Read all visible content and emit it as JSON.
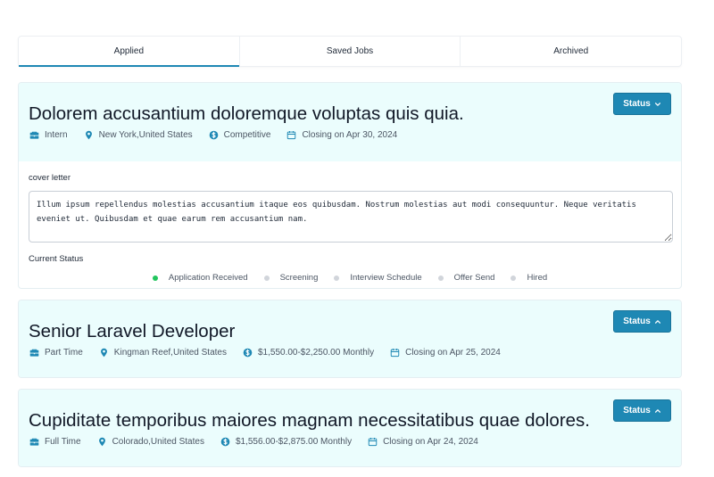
{
  "tabs": [
    {
      "label": "Applied",
      "active": true
    },
    {
      "label": "Saved Jobs",
      "active": false
    },
    {
      "label": "Archived",
      "active": false
    }
  ],
  "colors": {
    "accent": "#1e88b4",
    "card_header_bg": "#ebfdfd",
    "step_done": "#22c55e",
    "step_pending": "#d1d5db"
  },
  "jobs": [
    {
      "title": "Dolorem accusantium doloremque voluptas quis quia.",
      "status_label": "Status",
      "status_icon": "chevron-down-icon",
      "type": "Intern",
      "location": "New York,United States",
      "salary": "Competitive",
      "closing": "Closing on Apr 30, 2024",
      "cover_letter_label": "cover letter",
      "cover_letter": "Illum ipsum repellendus molestias accusantium itaque eos quibusdam. Nostrum molestias aut modi consequuntur. Neque veritatis eveniet ut. Quibusdam et quae earum rem accusantium nam.",
      "current_status_label": "Current Status",
      "steps": [
        {
          "label": "Application Received",
          "done": true
        },
        {
          "label": "Screening",
          "done": false
        },
        {
          "label": "Interview Schedule",
          "done": false
        },
        {
          "label": "Offer Send",
          "done": false
        },
        {
          "label": "Hired",
          "done": false
        }
      ]
    },
    {
      "title": "Senior Laravel Developer",
      "status_label": "Status",
      "status_icon": "chevron-up-icon",
      "type": "Part Time",
      "location": "Kingman Reef,United States",
      "salary": "$1,550.00-$2,250.00 Monthly",
      "closing": "Closing on Apr 25, 2024"
    },
    {
      "title": "Cupiditate temporibus maiores magnam necessitatibus quae dolores.",
      "status_label": "Status",
      "status_icon": "chevron-up-icon",
      "type": "Full Time",
      "location": "Colorado,United States",
      "salary": "$1,556.00-$2,875.00 Monthly",
      "closing": "Closing on Apr 24, 2024"
    }
  ]
}
